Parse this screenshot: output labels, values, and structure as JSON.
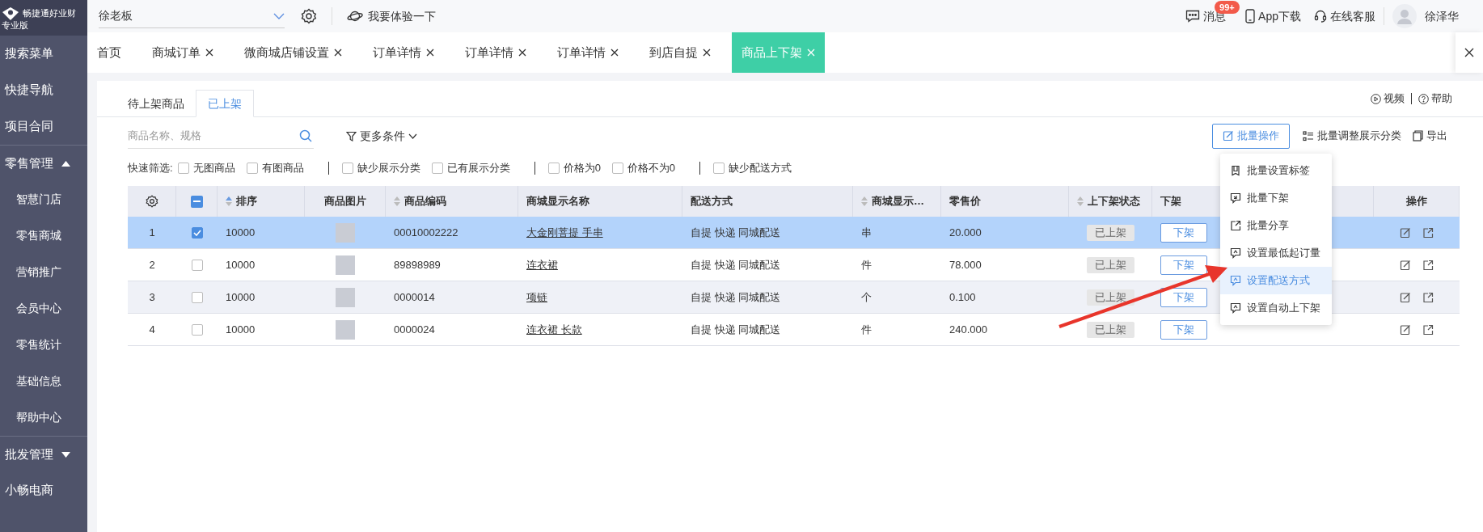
{
  "logo": {
    "name": "畅捷通好业财",
    "edition": "专业版"
  },
  "top_bar": {
    "account": "徐老板",
    "try_link": "我要体验一下",
    "messages": "消息",
    "message_badge": "99+",
    "app": "App下载",
    "service": "在线客服",
    "user": "徐泽华"
  },
  "sidebar": {
    "items": [
      {
        "kind": "item",
        "label": "搜索菜单"
      },
      {
        "kind": "item",
        "label": "快捷导航"
      },
      {
        "kind": "item",
        "label": "项目合同"
      },
      {
        "kind": "section",
        "label": "零售管理",
        "expanded": true,
        "children": [
          {
            "label": "智慧门店"
          },
          {
            "label": "零售商城"
          },
          {
            "label": "营销推广"
          },
          {
            "label": "会员中心"
          },
          {
            "label": "零售统计"
          },
          {
            "label": "基础信息"
          },
          {
            "label": "帮助中心"
          }
        ]
      },
      {
        "kind": "section",
        "label": "批发管理",
        "expanded": false
      },
      {
        "kind": "item",
        "label": "小畅电商"
      }
    ]
  },
  "tabs": [
    {
      "label": "首页",
      "closable": false,
      "selected": false
    },
    {
      "label": "商城订单",
      "closable": true,
      "selected": false
    },
    {
      "label": "微商城店铺设置",
      "closable": true,
      "selected": false
    },
    {
      "label": "订单详情",
      "closable": true,
      "selected": false
    },
    {
      "label": "订单详情",
      "closable": true,
      "selected": false
    },
    {
      "label": "订单详情",
      "closable": true,
      "selected": false
    },
    {
      "label": "到店自提",
      "closable": true,
      "selected": false
    },
    {
      "label": "商品上下架",
      "closable": true,
      "selected": true
    }
  ],
  "sub_tabs": [
    {
      "label": "待上架商品",
      "selected": false
    },
    {
      "label": "已上架",
      "selected": true
    }
  ],
  "help_links": [
    "视频",
    "帮助"
  ],
  "search": {
    "placeholder": "商品名称、规格"
  },
  "more_filters": "更多条件",
  "quick_filter": {
    "label": "快速筛选:",
    "groups": [
      [
        {
          "label": "无图商品",
          "checked": false
        },
        {
          "label": "有图商品",
          "checked": false
        }
      ],
      [
        {
          "label": "缺少展示分类",
          "checked": false
        },
        {
          "label": "已有展示分类",
          "checked": false
        }
      ],
      [
        {
          "label": "价格为0",
          "checked": false
        },
        {
          "label": "价格不为0",
          "checked": false
        }
      ],
      [
        {
          "label": "缺少配送方式",
          "checked": false
        }
      ]
    ]
  },
  "actions": {
    "batch": "批量操作",
    "adjust": "批量调整展示分类",
    "export": "导出"
  },
  "batch_menu": [
    {
      "label": "批量设置标签",
      "selected": false
    },
    {
      "label": "批量下架",
      "selected": false
    },
    {
      "label": "批量分享",
      "selected": false
    },
    {
      "label": "设置最低起订量",
      "selected": false
    },
    {
      "label": "设置配送方式",
      "selected": true
    },
    {
      "label": "设置自动上下架",
      "selected": false
    }
  ],
  "table": {
    "select_all": {
      "indeterminate": true
    },
    "columns": [
      {
        "label": "排序",
        "sortable": true
      },
      {
        "label": "商品图片",
        "sortable": false
      },
      {
        "label": "商品编码",
        "sortable": true
      },
      {
        "label": "商城显示名称",
        "sortable": false
      },
      {
        "label": "配送方式",
        "sortable": false
      },
      {
        "label": "商城显示…",
        "sortable": true
      },
      {
        "label": "零售价",
        "sortable": false
      },
      {
        "label": "上下架状态",
        "sortable": true
      },
      {
        "label": "下架",
        "sortable": false
      },
      {
        "label": "操作",
        "sortable": false
      }
    ],
    "rows": [
      {
        "index": "1",
        "selected": true,
        "checked": true,
        "sort": "10000",
        "code": "00010002222",
        "name": "大金刚菩提 手串",
        "delivery": "自提 快递 同城配送",
        "unit": "串",
        "price": "20.000",
        "status": "已上架",
        "action": "下架"
      },
      {
        "index": "2",
        "selected": false,
        "checked": false,
        "sort": "10000",
        "code": "89898989",
        "name": "连衣裙",
        "delivery": "自提 快递 同城配送",
        "unit": "件",
        "price": "78.000",
        "status": "已上架",
        "action": "下架"
      },
      {
        "index": "3",
        "selected": false,
        "checked": false,
        "sort": "10000",
        "code": "0000014",
        "name": "项链",
        "delivery": "自提 快递 同城配送",
        "unit": "个",
        "price": "0.100",
        "status": "已上架",
        "action": "下架"
      },
      {
        "index": "4",
        "selected": false,
        "checked": false,
        "sort": "10000",
        "code": "0000024",
        "name": "连衣裙 长款",
        "delivery": "自提 快递 同城配送",
        "unit": "件",
        "price": "240.000",
        "status": "已上架",
        "action": "下架"
      }
    ]
  }
}
